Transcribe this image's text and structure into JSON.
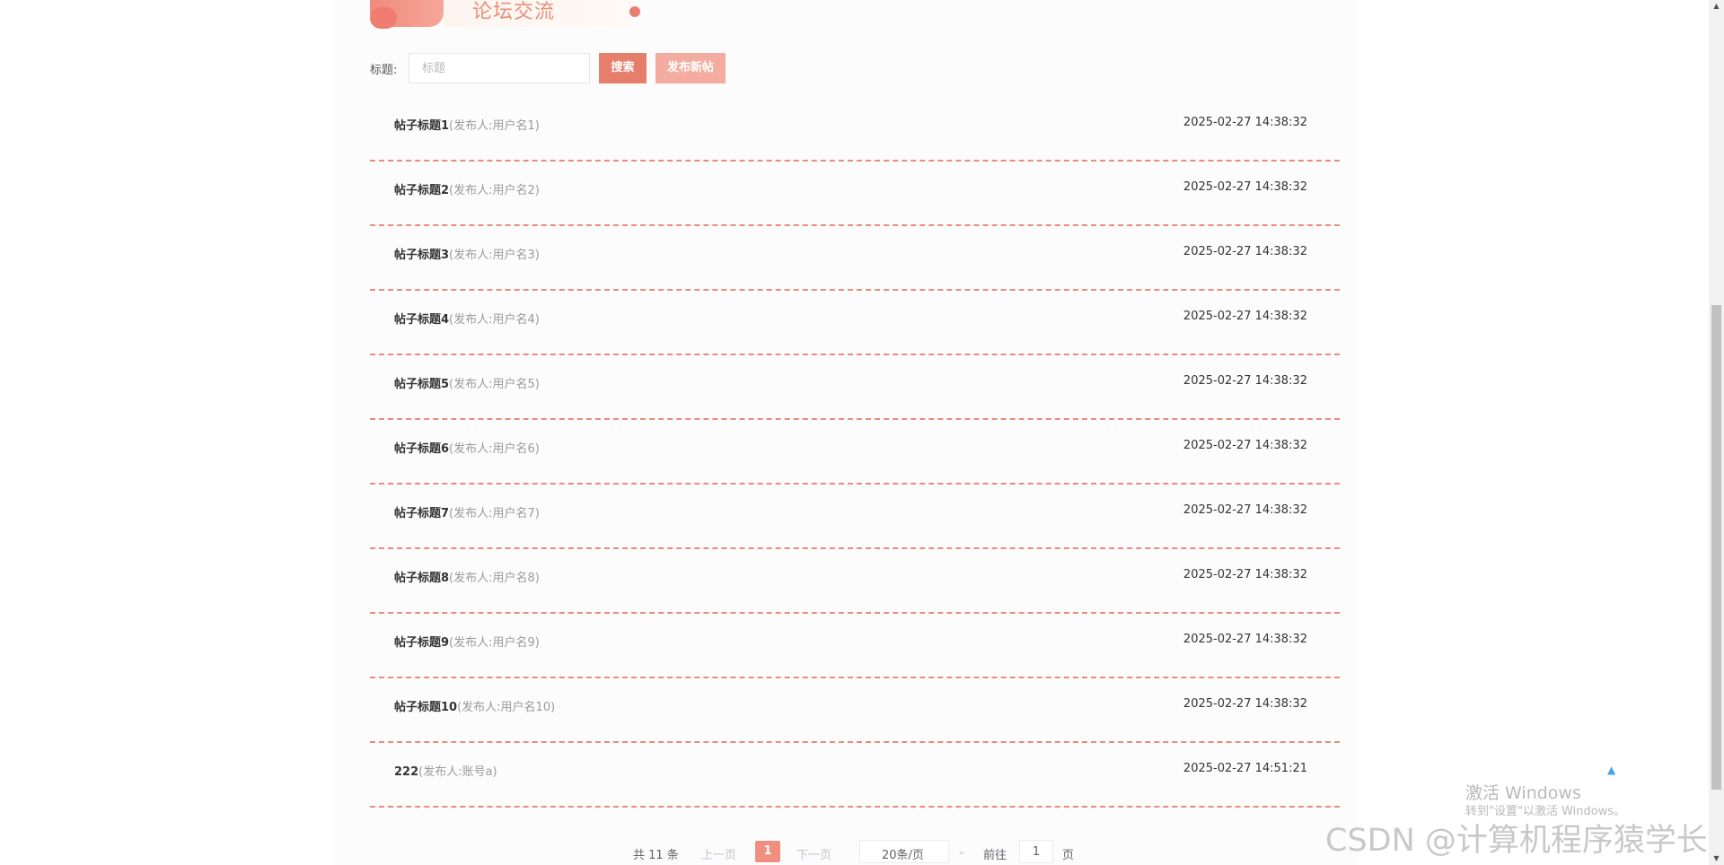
{
  "header": {
    "title": "论坛交流"
  },
  "search": {
    "label": "标题:",
    "placeholder": "标题",
    "search_button": "搜索",
    "new_post_button": "发布新帖"
  },
  "posts": [
    {
      "title": "帖子标题1",
      "author": "(发布人:用户名1)",
      "time": "2025-02-27 14:38:32"
    },
    {
      "title": "帖子标题2",
      "author": "(发布人:用户名2)",
      "time": "2025-02-27 14:38:32"
    },
    {
      "title": "帖子标题3",
      "author": "(发布人:用户名3)",
      "time": "2025-02-27 14:38:32"
    },
    {
      "title": "帖子标题4",
      "author": "(发布人:用户名4)",
      "time": "2025-02-27 14:38:32"
    },
    {
      "title": "帖子标题5",
      "author": "(发布人:用户名5)",
      "time": "2025-02-27 14:38:32"
    },
    {
      "title": "帖子标题6",
      "author": "(发布人:用户名6)",
      "time": "2025-02-27 14:38:32"
    },
    {
      "title": "帖子标题7",
      "author": "(发布人:用户名7)",
      "time": "2025-02-27 14:38:32"
    },
    {
      "title": "帖子标题8",
      "author": "(发布人:用户名8)",
      "time": "2025-02-27 14:38:32"
    },
    {
      "title": "帖子标题9",
      "author": "(发布人:用户名9)",
      "time": "2025-02-27 14:38:32"
    },
    {
      "title": "帖子标题10",
      "author": "(发布人:用户名10)",
      "time": "2025-02-27 14:38:32"
    },
    {
      "title": "222",
      "author": "(发布人:账号a)",
      "time": "2025-02-27 14:51:21"
    }
  ],
  "pagination": {
    "total": "共 11 条",
    "prev": "上一页",
    "current": "1",
    "next": "下一页",
    "page_size": "20条/页",
    "goto_label": "前往",
    "goto_value": "1",
    "page_suffix": "页"
  },
  "watermarks": {
    "windows_line1": "激活 Windows",
    "windows_line2": "转到\"设置\"以激活 Windows。",
    "csdn": "CSDN @计算机程序猿学长"
  },
  "colors": {
    "accent": "#e57f6c",
    "accent_light": "#f4aca0",
    "divider": "#ea8b7c"
  }
}
